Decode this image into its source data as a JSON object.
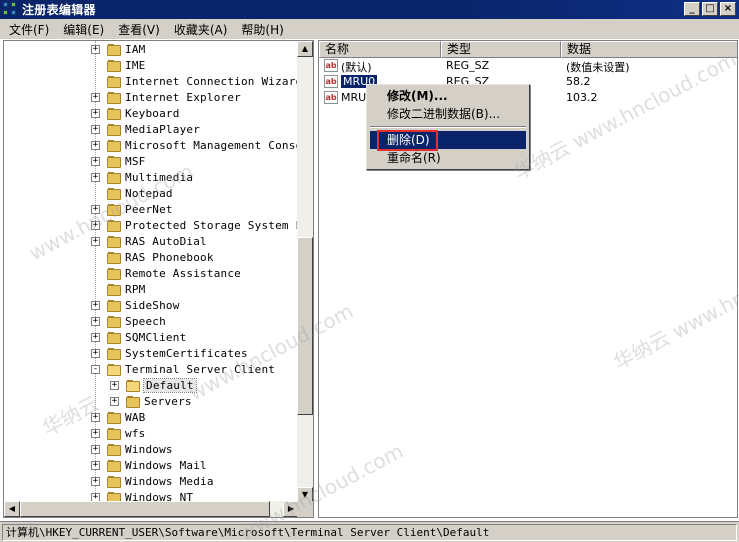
{
  "window": {
    "title": "注册表编辑器",
    "buttons": [
      "_",
      "□",
      "×"
    ]
  },
  "menu": [
    "文件(F)",
    "编辑(E)",
    "查看(V)",
    "收藏夹(A)",
    "帮助(H)"
  ],
  "tree": {
    "nodes": [
      {
        "label": "IAM",
        "expander": "+"
      },
      {
        "label": "IME",
        "expander": ""
      },
      {
        "label": "Internet Connection Wizard",
        "expander": ""
      },
      {
        "label": "Internet Explorer",
        "expander": "+"
      },
      {
        "label": "Keyboard",
        "expander": "+"
      },
      {
        "label": "MediaPlayer",
        "expander": "+"
      },
      {
        "label": "Microsoft Management Console",
        "expander": "+"
      },
      {
        "label": "MSF",
        "expander": "+"
      },
      {
        "label": "Multimedia",
        "expander": "+"
      },
      {
        "label": "Notepad",
        "expander": ""
      },
      {
        "label": "PeerNet",
        "expander": "+"
      },
      {
        "label": "Protected Storage System Prov",
        "expander": "+"
      },
      {
        "label": "RAS AutoDial",
        "expander": "+"
      },
      {
        "label": "RAS Phonebook",
        "expander": ""
      },
      {
        "label": "Remote Assistance",
        "expander": ""
      },
      {
        "label": "RPM",
        "expander": ""
      },
      {
        "label": "SideShow",
        "expander": "+"
      },
      {
        "label": "Speech",
        "expander": "+"
      },
      {
        "label": "SQMClient",
        "expander": "+"
      },
      {
        "label": "SystemCertificates",
        "expander": "+"
      },
      {
        "label": "Terminal Server Client",
        "expander": "-"
      },
      {
        "label": "Default",
        "expander": "+",
        "child": true,
        "selected": true
      },
      {
        "label": "Servers",
        "expander": "+",
        "child": true
      },
      {
        "label": "WAB",
        "expander": "+"
      },
      {
        "label": "wfs",
        "expander": "+"
      },
      {
        "label": "Windows",
        "expander": "+"
      },
      {
        "label": "Windows Mail",
        "expander": "+"
      },
      {
        "label": "Windows Media",
        "expander": "+"
      },
      {
        "label": "Windows NT",
        "expander": "+"
      }
    ]
  },
  "list": {
    "columns": [
      "名称",
      "类型",
      "数据"
    ],
    "rows": [
      {
        "name": "(默认)",
        "type": "REG_SZ",
        "data": "(数值未设置)",
        "icon": "ab"
      },
      {
        "name": "MRU0",
        "type": "REG_SZ",
        "data": "58.2",
        "icon": "ab",
        "selected": true
      },
      {
        "name": "MRU1",
        "type": "",
        "data": "103.2",
        "icon": "ab"
      }
    ]
  },
  "context_menu": {
    "items": [
      "修改(M)...",
      "修改二进制数据(B)...",
      "删除(D)",
      "重命名(R)"
    ]
  },
  "status": {
    "path": "计算机\\HKEY_CURRENT_USER\\Software\\Microsoft\\Terminal Server Client\\Default"
  },
  "watermark": {
    "text_cn": "华纳云",
    "text_url": "www.hncloud.com"
  },
  "colors": {
    "title_bar": "#0a246a",
    "chrome": "#d4d0c8",
    "selection": "#0a246a",
    "highlight_box": "#e03030"
  }
}
